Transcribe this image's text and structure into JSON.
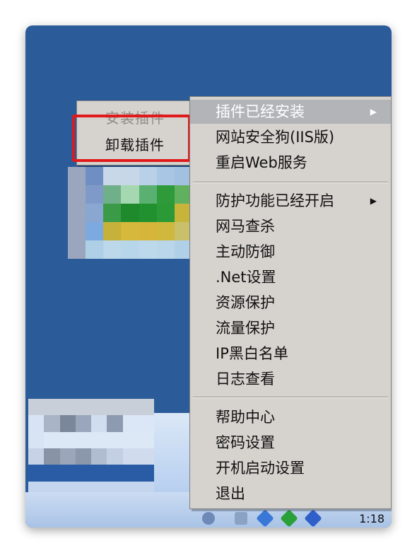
{
  "submenu": {
    "items": [
      {
        "label": "安装插件",
        "disabled": true
      },
      {
        "label": "卸载插件",
        "disabled": false
      }
    ]
  },
  "menu": {
    "group1": [
      {
        "label": "插件已经安装",
        "has_submenu": true,
        "highlighted": true
      },
      {
        "label": "网站安全狗(IIS版)"
      },
      {
        "label": "重启Web服务"
      }
    ],
    "group2": [
      {
        "label": "防护功能已经开启",
        "has_submenu": true
      },
      {
        "label": "网马查杀"
      },
      {
        "label": "主动防御"
      },
      {
        "label": ".Net设置"
      },
      {
        "label": "资源保护"
      },
      {
        "label": "流量保护"
      },
      {
        "label": "IP黑白名单"
      },
      {
        "label": "日志查看"
      }
    ],
    "group3": [
      {
        "label": "帮助中心"
      },
      {
        "label": "密码设置"
      },
      {
        "label": "开机启动设置"
      },
      {
        "label": "退出"
      }
    ]
  },
  "tray": {
    "time": "1:18"
  },
  "colors": {
    "highlight_box": "#e0191b",
    "menu_bg": "#d6d3ce",
    "desktop": "#2b5b99"
  }
}
